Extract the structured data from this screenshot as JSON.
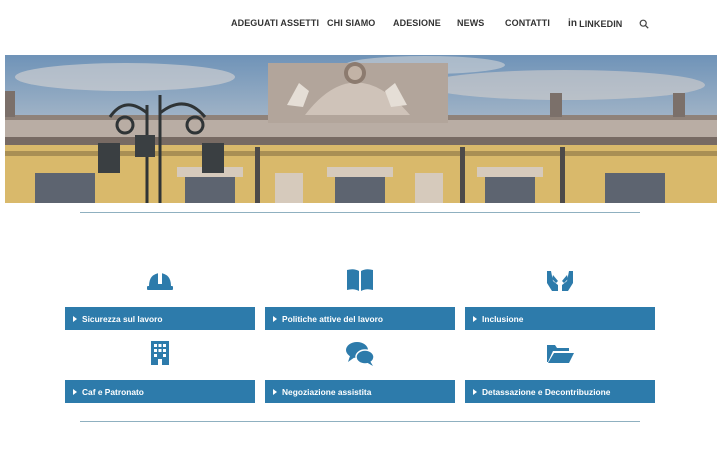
{
  "nav": {
    "items": [
      "ADEGUATI ASSETTI",
      "CHI SIAMO",
      "ADESIONE",
      "NEWS",
      "CONTATTI"
    ],
    "linkedin_icon_text": "in",
    "linkedin_label": "LINKEDIN"
  },
  "services": [
    {
      "label": "Sicurezza sul lavoro",
      "icon": "hard-hat-icon"
    },
    {
      "label": "Politiche attive del lavoro",
      "icon": "open-book-icon"
    },
    {
      "label": "Inclusione",
      "icon": "helping-hands-icon"
    },
    {
      "label": "Caf e Patronato",
      "icon": "office-building-icon"
    },
    {
      "label": "Negoziazione assistita",
      "icon": "chat-bubbles-icon"
    },
    {
      "label": "Detassazione e Decontribuzione",
      "icon": "open-folder-icon"
    }
  ],
  "colors": {
    "accent": "#2d7bab",
    "divider": "#8fb0c0"
  }
}
